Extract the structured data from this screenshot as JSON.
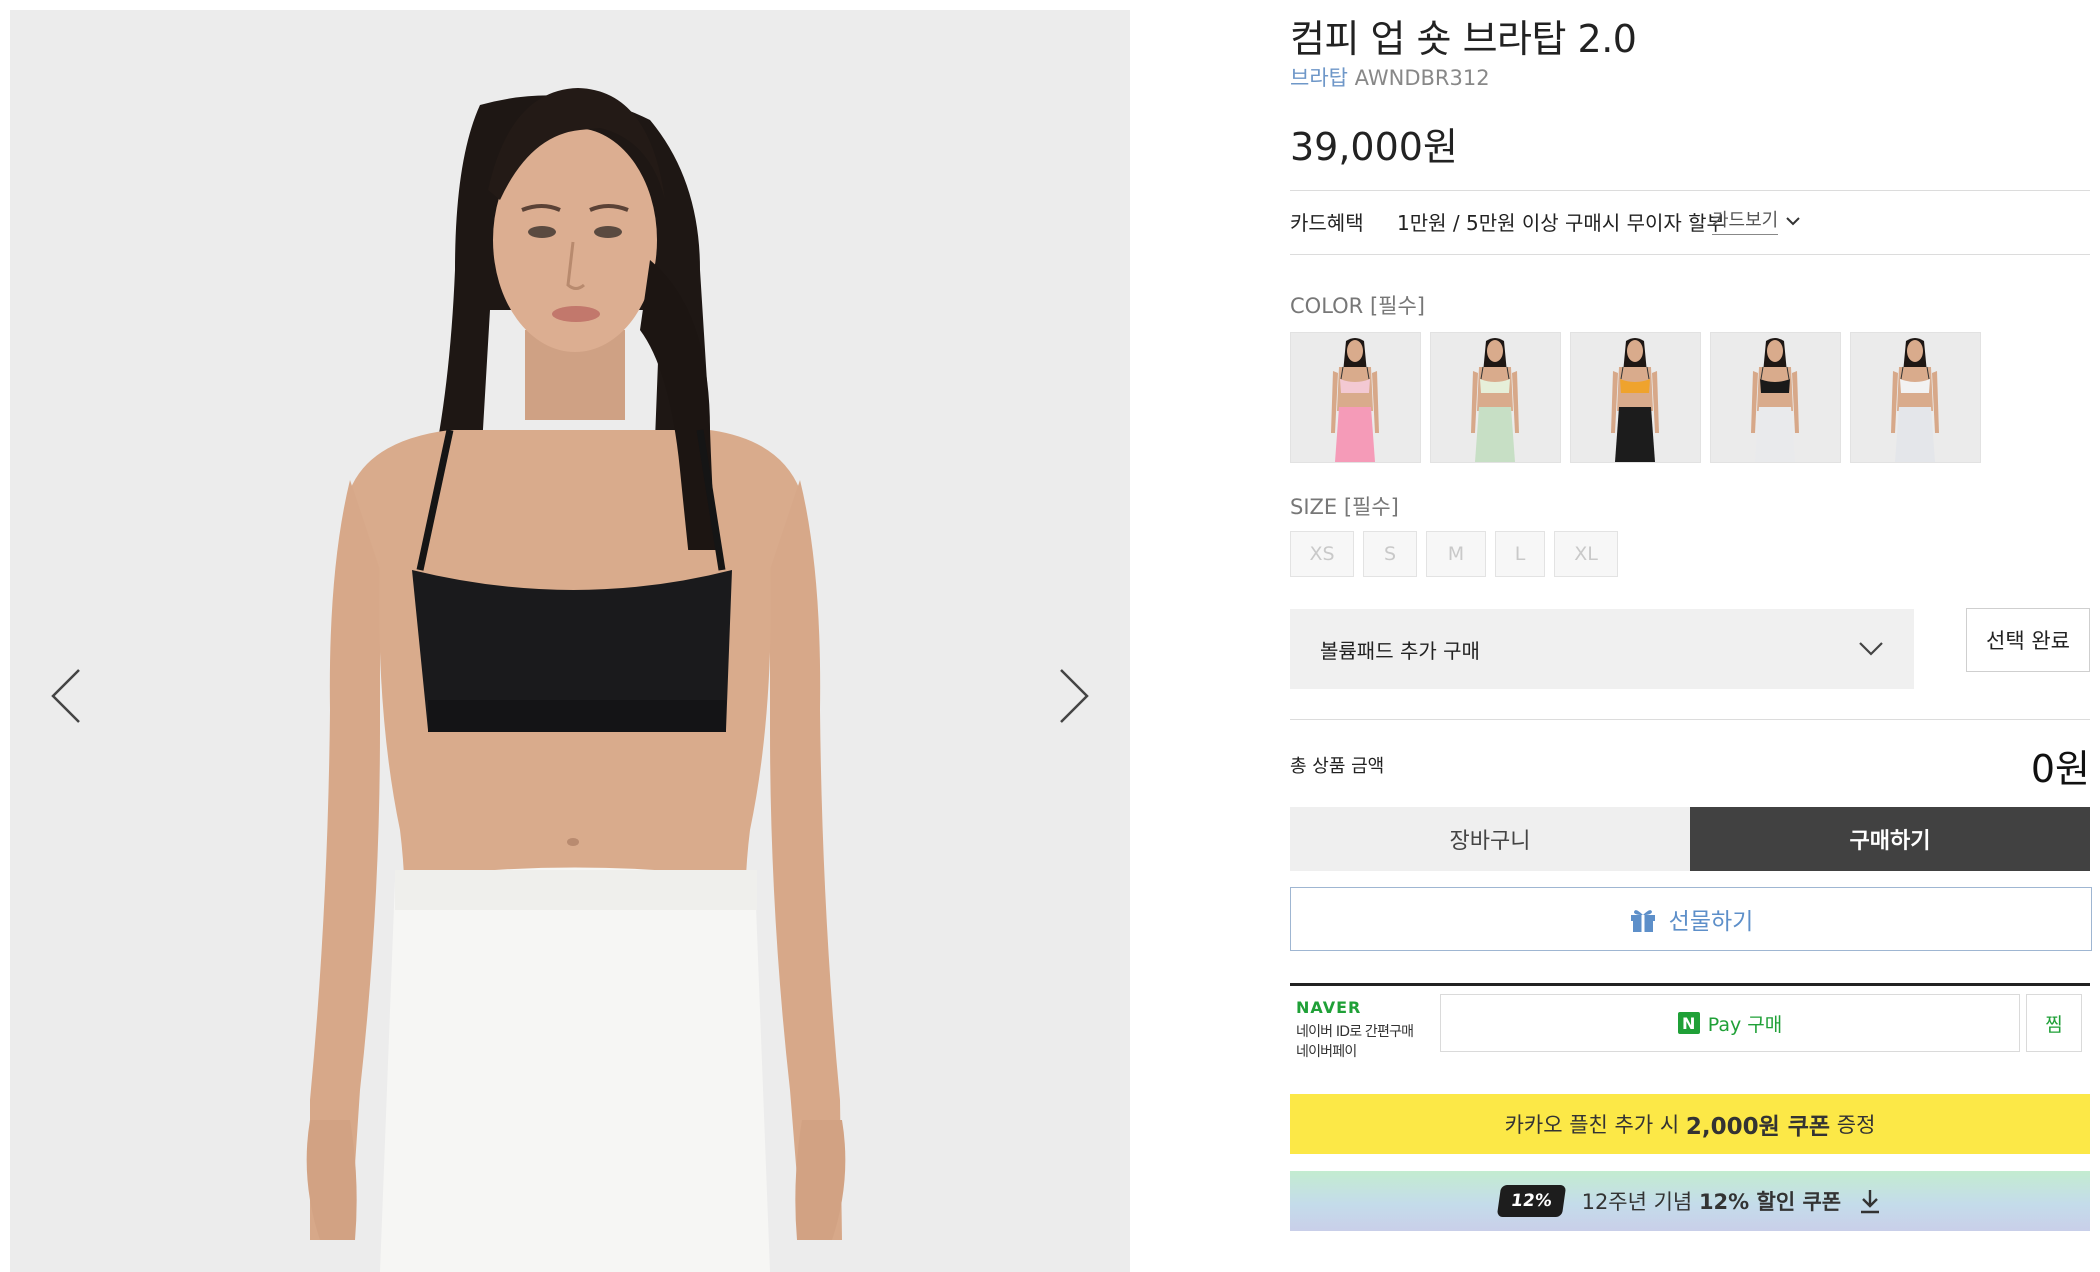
{
  "gallery": {
    "prev_label": "previous image",
    "next_label": "next image"
  },
  "product": {
    "name": "컴피 업 숏 브라탑 2.0",
    "category": "브라탑",
    "code": "AWNDBR312",
    "price": "39,000원"
  },
  "card_benefit": {
    "label": "카드혜택",
    "text": "1만원 / 5만원 이상 구매시 무이자 할부",
    "link": "카드보기"
  },
  "color": {
    "label": "COLOR [필수]",
    "options": [
      {
        "name": "pink",
        "top": "#f3c9d3",
        "bottom": "#f59bb8"
      },
      {
        "name": "mint",
        "top": "#e6efd9",
        "bottom": "#c7dfc5"
      },
      {
        "name": "yellow",
        "top": "#efa32d",
        "bottom": "#1c1c1c"
      },
      {
        "name": "black",
        "top": "#1a1a1a",
        "bottom": "#e9eaec"
      },
      {
        "name": "white",
        "top": "#f2f2f2",
        "bottom": "#e4e6ea"
      }
    ]
  },
  "size": {
    "label": "SIZE [필수]",
    "options": [
      "XS",
      "S",
      "M",
      "L",
      "XL"
    ]
  },
  "addon": {
    "select_label": "볼륨패드 추가 구매",
    "confirm_label": "선택 완료"
  },
  "total": {
    "label": "총 상품 금액",
    "value": "0원"
  },
  "actions": {
    "cart": "장바구니",
    "buy": "구매하기",
    "gift": "선물하기"
  },
  "naver": {
    "brand": "NAVER",
    "line1": "네이버 ID로 간편구매",
    "line2": "네이버페이",
    "pay_badge": "N",
    "pay_label": "Pay 구매",
    "zzim": "찜"
  },
  "kakao": {
    "prefix": "카카오 플친 추가 시 ",
    "amount": "2,000원 쿠폰",
    "suffix": " 증정"
  },
  "anniversary": {
    "badge": "12%",
    "prefix": "12주년 기념 ",
    "bold": "12% 할인 쿠폰"
  },
  "colors": {
    "accent_blue": "#5d8fc9",
    "naver_green": "#1fa037",
    "kakao_yellow": "#fce847",
    "buy_dark": "#414141"
  }
}
